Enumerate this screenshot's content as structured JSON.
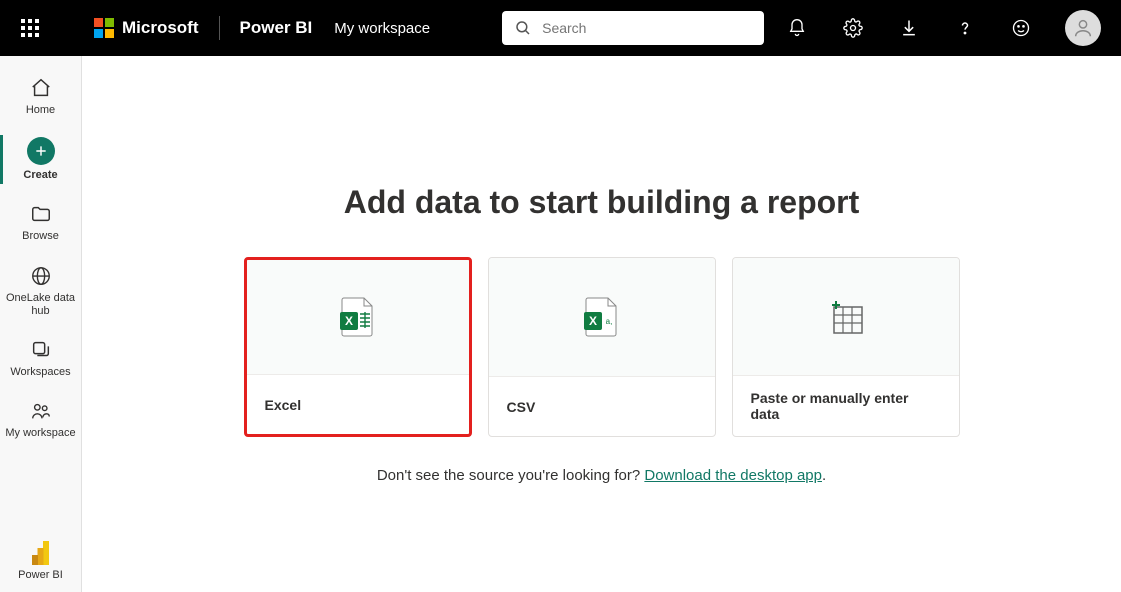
{
  "topbar": {
    "brand": "Microsoft",
    "product": "Power BI",
    "workspace": "My workspace",
    "search_placeholder": "Search"
  },
  "sidebar": {
    "items": [
      {
        "label": "Home"
      },
      {
        "label": "Create"
      },
      {
        "label": "Browse"
      },
      {
        "label": "OneLake data hub"
      },
      {
        "label": "Workspaces"
      },
      {
        "label": "My workspace"
      },
      {
        "label": "Power BI"
      }
    ]
  },
  "main": {
    "title": "Add data to start building a report",
    "cards": [
      {
        "label": "Excel"
      },
      {
        "label": "CSV"
      },
      {
        "label": "Paste or manually enter data"
      }
    ],
    "footer_prefix": "Don't see the source you're looking for? ",
    "footer_link": "Download the desktop app",
    "footer_suffix": "."
  }
}
